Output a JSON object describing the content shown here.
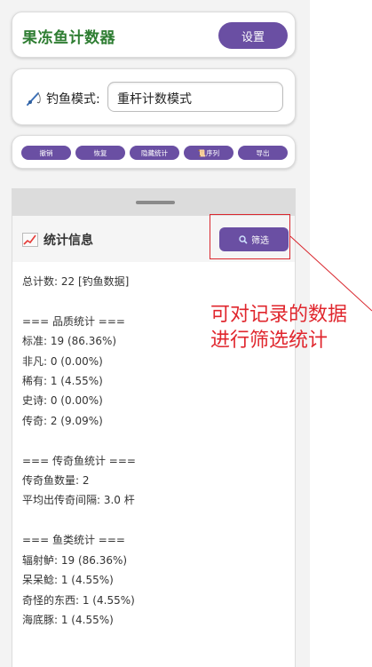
{
  "app": {
    "title": "果冻鱼计数器",
    "settings_label": "设置"
  },
  "mode": {
    "label": "钓鱼模式:",
    "value": "重杆计数模式"
  },
  "toolbar": {
    "undo": "撤销",
    "redo": "恢复",
    "hide_stats": "隐藏统计",
    "sequence": "📜序列",
    "export": "导出"
  },
  "stats": {
    "title": "统计信息",
    "filter_label": "筛选",
    "body": "总计数: 22 [钓鱼数据]\n\n=== 品质统计 ===\n标准: 19 (86.36%)\n非凡: 0 (0.00%)\n稀有: 1 (4.55%)\n史诗: 0 (0.00%)\n传奇: 2 (9.09%)\n\n=== 传奇鱼统计 ===\n传奇鱼数量: 2\n平均出传奇间隔: 3.0 杆\n\n=== 鱼类统计 ===\n辐射鲈: 19 (86.36%)\n呆呆鲶: 1 (4.55%)\n奇怪的东西: 1 (4.55%)\n海底豚: 1 (4.55%)"
  },
  "annotation": {
    "text": "可对记录的数据\n进行筛选统计"
  },
  "colors": {
    "accent": "#6a4fa3",
    "title_green": "#2e7d32",
    "annotation_red": "#e0262d"
  },
  "icons": {
    "mode": "fishing-rod-icon",
    "stats": "chart-increasing-icon",
    "filter": "magnifier-icon"
  }
}
